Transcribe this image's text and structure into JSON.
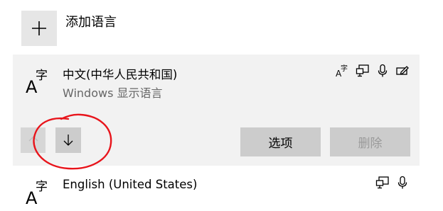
{
  "add_language": {
    "label": "添加语言",
    "icon": "plus-icon"
  },
  "languages": [
    {
      "name": "中文(中华人民共和国)",
      "subtitle": "Windows 显示语言",
      "icon_glyph_a": "A",
      "icon_glyph_zi": "字",
      "features": [
        "language-pack-icon",
        "display-icon",
        "microphone-icon",
        "handwriting-icon"
      ],
      "selected": true
    },
    {
      "name": "English (United States)",
      "icon_glyph_a": "A",
      "icon_glyph_zi": "字",
      "features": [
        "display-icon",
        "microphone-icon"
      ],
      "selected": false
    }
  ],
  "controls": {
    "move_up_enabled": false,
    "move_down_enabled": true,
    "options_label": "选项",
    "remove_label": "删除",
    "remove_enabled": false
  },
  "colors": {
    "panel_bg": "#f2f2f2",
    "button_bg": "#cccccc",
    "annotation": "#e8141b"
  }
}
